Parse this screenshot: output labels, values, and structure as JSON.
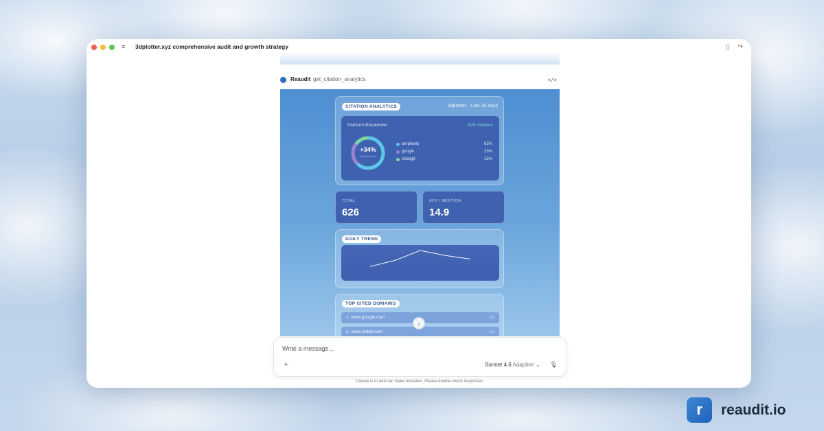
{
  "window": {
    "chat_title": "3dplotter.xyz comprehensive audit and growth strategy"
  },
  "tool_call": {
    "name": "Reaudit",
    "function": "get_citation_analytics",
    "code_icon": "</>"
  },
  "citation_analytics": {
    "badge": "CITATION ANALYTICS",
    "subtitle": "3dplotter · Last 30 days",
    "platform_breakdown": {
      "title": "Platform Breakdown",
      "count": "626 citations",
      "change": "+34%",
      "change_caption": "vs last month",
      "platforms": [
        {
          "name": "perplexity",
          "percent": "62%",
          "value": 62,
          "color": "#5cc8e8"
        },
        {
          "name": "google",
          "percent": "23%",
          "value": 23,
          "color": "#9a83cf"
        },
        {
          "name": "chatgpt",
          "percent": "15%",
          "value": 15,
          "color": "#7fd6a4"
        }
      ]
    }
  },
  "stats": {
    "total_label": "TOTAL",
    "total_value": "626",
    "avg_label": "AVG / MENTION",
    "avg_value": "14.9"
  },
  "daily_trend": {
    "badge": "DAILY TREND",
    "points": [
      12,
      22,
      38,
      30,
      24
    ]
  },
  "top_domains": {
    "badge": "TOP CITED DOMAINS",
    "rows": [
      {
        "label": "1. www.google.com",
        "count": "82"
      },
      {
        "label": "2. www.reddit.com",
        "count": "61"
      }
    ]
  },
  "composer": {
    "placeholder": "Write a message...",
    "model": "Sonnet 4.6",
    "mode": "Adaptive"
  },
  "disclaimer": "Claude is AI and can make mistakes. Please double-check responses.",
  "brand": {
    "name": "reaudit.io"
  }
}
